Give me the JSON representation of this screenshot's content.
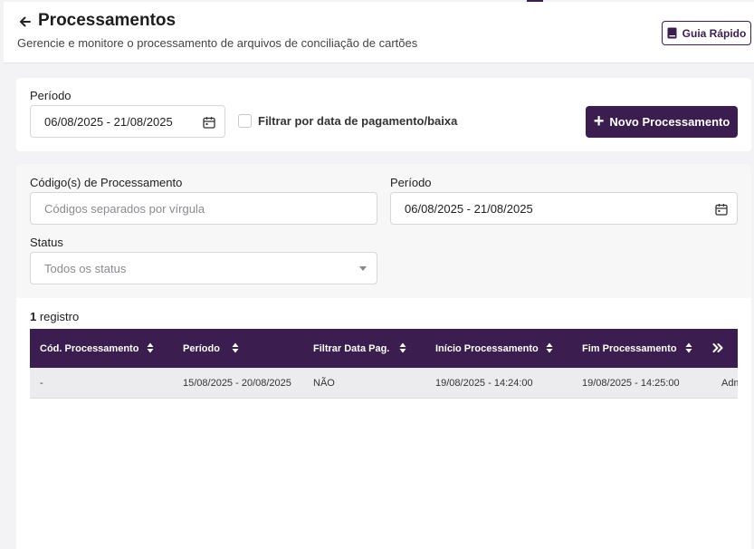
{
  "header": {
    "title": "Processamentos",
    "subtitle": "Gerencie e monitore o processamento de arquivos de conciliação de cartões",
    "guide_label": "Guia Rápido"
  },
  "new_process": {
    "period_label": "Período",
    "period_value": "06/08/2025 - 21/08/2025",
    "filter_payment_label": "Filtrar por data de pagamento/baixa",
    "filter_payment_checked": false,
    "button_label": "Novo Processamento"
  },
  "filters": {
    "codes_label": "Código(s) de Processamento",
    "codes_placeholder": "Códigos separados por vírgula",
    "period_label": "Período",
    "period_value": "06/08/2025 - 21/08/2025",
    "status_label": "Status",
    "status_placeholder": "Todos os status"
  },
  "results": {
    "count_number": "1",
    "count_suffix": " registro",
    "columns": [
      "Cód. Processamento",
      "Período",
      "Filtrar Data Pag.",
      "Início Processamento",
      "Fim Processamento"
    ],
    "rows": [
      [
        "-",
        "15/08/2025 - 20/08/2025",
        "NÃO",
        "19/08/2025 - 14:24:00",
        "19/08/2025 - 14:25:00",
        "Adm"
      ]
    ]
  },
  "colors": {
    "primary": "#3b1d4f",
    "background": "#f3f3f5",
    "row_bg": "#ececee"
  },
  "icons": [
    "back-arrow-icon",
    "book-icon",
    "calendar-icon",
    "plus-icon",
    "sort-icon",
    "chevron-double-right-icon",
    "chevron-down-icon"
  ]
}
